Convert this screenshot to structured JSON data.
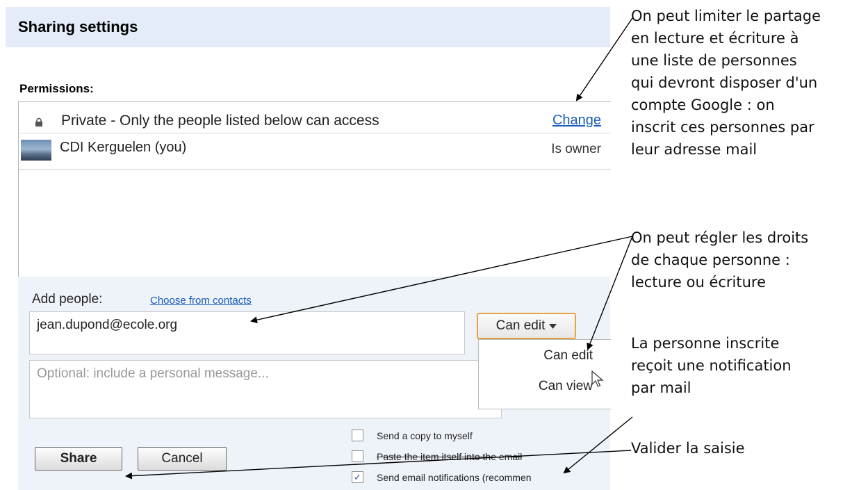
{
  "dialog": {
    "title": "Sharing settings",
    "permissions_label": "Permissions:",
    "visibility": {
      "icon": "lock-icon",
      "text": "Private - Only the people listed below can access",
      "change_link": "Change"
    },
    "people": [
      {
        "avatar": "user-avatar",
        "name": "CDI Kerguelen (you)",
        "role": "Is owner"
      }
    ],
    "add_people": {
      "label": "Add people:",
      "contacts_link": "Choose from contacts",
      "email_value": "jean.dupond@ecole.org",
      "message_placeholder": "Optional: include a personal message...",
      "permission_select": "Can edit",
      "permission_options": [
        "Can edit",
        "Can view"
      ]
    },
    "options": [
      {
        "label": "Send a copy to myself",
        "checked": false
      },
      {
        "label": "Paste the item itself into the email",
        "checked": false
      },
      {
        "label": "Send email notifications (recommen",
        "checked": true
      }
    ],
    "buttons": {
      "share": "Share",
      "cancel": "Cancel"
    },
    "colors": {
      "title_bar": "#e3ecf8",
      "link": "#1a5dbb",
      "select_border": "#e8a33d",
      "add_area": "#eef2f9"
    }
  },
  "annotations": {
    "a1": [
      "On peut limiter le partage",
      "en lecture et écriture à",
      "une liste de personnes",
      "qui devront disposer d'un",
      "compte Google : on",
      "inscrit ces personnes par",
      "leur adresse mail"
    ],
    "a2": [
      "On peut régler les droits",
      "de chaque personne :",
      "lecture ou écriture"
    ],
    "a3": [
      "La personne inscrite",
      "reçoit une notification",
      "par mail"
    ],
    "a4": [
      "Valider la saisie"
    ]
  }
}
